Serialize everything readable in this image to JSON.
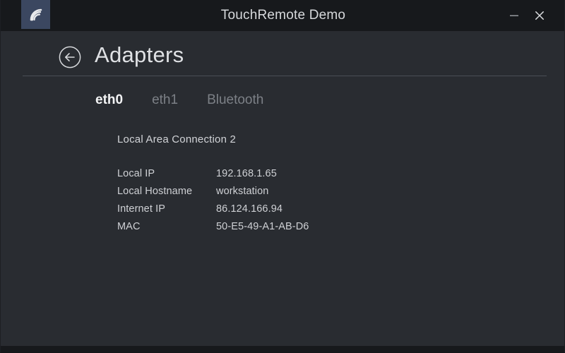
{
  "window": {
    "title": "TouchRemote Demo",
    "icon": "wifi-signal-icon",
    "controls": {
      "minimize_label": "–",
      "close_label": "✕"
    },
    "colors": {
      "titlebar_bg": "#17191c",
      "body_bg": "#292c31",
      "icon_bg": "#3b4760",
      "accent_text": "#f2f3f4",
      "muted_text": "#7c8086",
      "divider": "#4a4e55"
    }
  },
  "header": {
    "back_icon": "back-arrow-circle-icon",
    "title": "Adapters"
  },
  "tabs": [
    {
      "label": "eth0",
      "active": true
    },
    {
      "label": "eth1",
      "active": false
    },
    {
      "label": "Bluetooth",
      "active": false
    }
  ],
  "content": {
    "connection_name": "Local Area Connection 2",
    "details": [
      {
        "label": "Local IP",
        "value": "192.168.1.65"
      },
      {
        "label": "Local Hostname",
        "value": "workstation"
      },
      {
        "label": "Internet IP",
        "value": "86.124.166.94"
      },
      {
        "label": "MAC",
        "value": "50-E5-49-A1-AB-D6"
      }
    ]
  }
}
